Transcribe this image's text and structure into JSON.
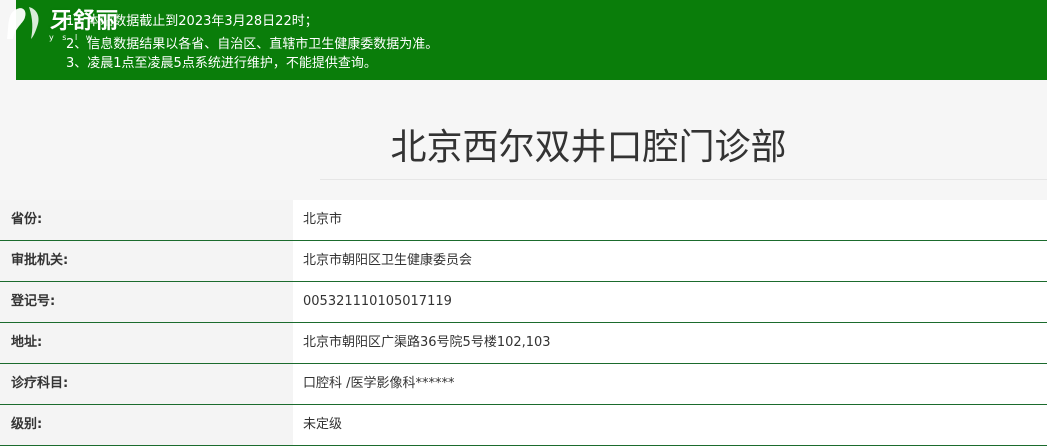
{
  "notice": {
    "line1": "1、本站数据截止到2023年3月28日22时；",
    "line2": "2、信息数据结果以各省、自治区、直辖市卫生健康委数据为准。",
    "line3": "3、凌晨1点至凌晨5点系统进行维护，不能提供查询。"
  },
  "logo": {
    "name": "牙舒丽",
    "sub": "y s l w"
  },
  "page_title": "北京西尔双井口腔门诊部",
  "rows": [
    {
      "label": "省份:",
      "value": "北京市"
    },
    {
      "label": "审批机关:",
      "value": "北京市朝阳区卫生健康委员会"
    },
    {
      "label": "登记号:",
      "value": "005321110105017119"
    },
    {
      "label": "地址:",
      "value": "北京市朝阳区广渠路36号院5号楼102,103"
    },
    {
      "label": "诊疗科目:",
      "value": "口腔科 /医学影像科******"
    },
    {
      "label": "级别:",
      "value": "未定级"
    }
  ],
  "colors": {
    "notice_bg": "#0a7d0a",
    "row_border": "#1b6b2d"
  }
}
